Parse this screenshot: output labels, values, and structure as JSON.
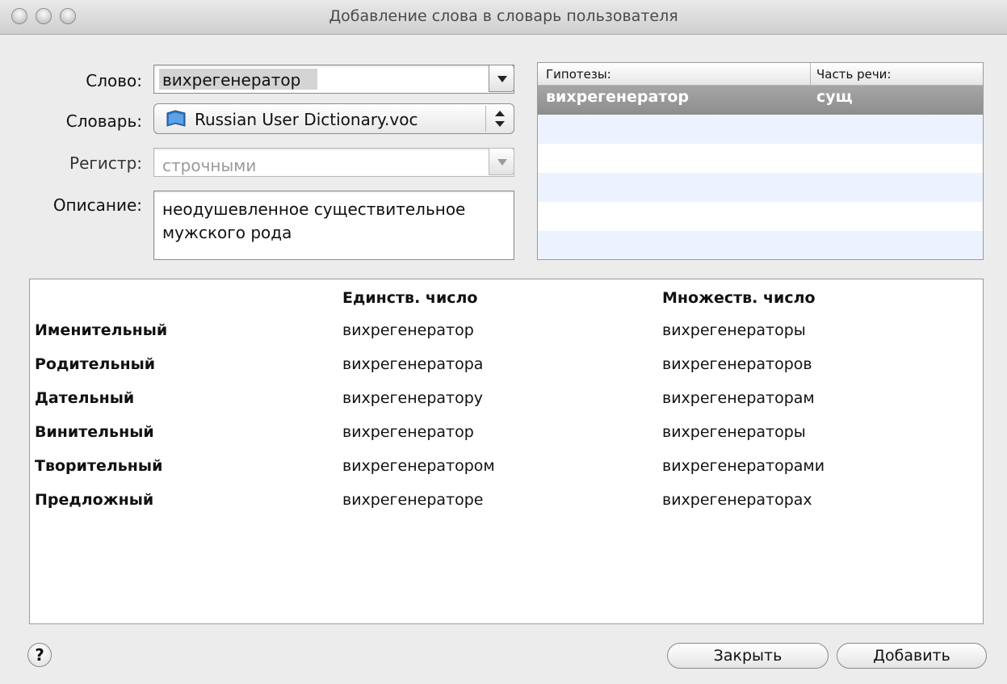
{
  "window": {
    "title": "Добавление слова в словарь пользователя"
  },
  "form": {
    "word_label": "Слово:",
    "word_value": "вихрегенератор",
    "dictionary_label": "Словарь:",
    "dictionary_value": "Russian User Dictionary.voc",
    "case_label": "Регистр:",
    "case_value": "строчными",
    "description_label": "Описание:",
    "description_value": "неодушевленное существительное мужского рода"
  },
  "hypotheses": {
    "columns": [
      "Гипотезы:",
      "Часть речи:"
    ],
    "rows": [
      {
        "word": "вихрегенератор",
        "pos": "сущ",
        "selected": true
      }
    ]
  },
  "declension": {
    "headers": [
      "",
      "Единств. число",
      "Множеств. число"
    ],
    "rows": [
      [
        "Именительный",
        "вихрегенератор",
        "вихрегенераторы"
      ],
      [
        "Родительный",
        "вихрегенератора",
        "вихрегенераторов"
      ],
      [
        "Дательный",
        "вихрегенератору",
        "вихрегенераторам"
      ],
      [
        "Винительный",
        "вихрегенератор",
        "вихрегенераторы"
      ],
      [
        "Творительный",
        "вихрегенератором",
        "вихрегенераторами"
      ],
      [
        "Предложный",
        "вихрегенераторе",
        "вихрегенераторах"
      ]
    ]
  },
  "buttons": {
    "help": "?",
    "close": "Закрыть",
    "add": "Добавить"
  },
  "colors": {
    "selection": "#8d8d8d",
    "alt_row": "#edf3fe",
    "word_highlight": "#d4d4d4",
    "book_icon": "#2a73c8"
  }
}
